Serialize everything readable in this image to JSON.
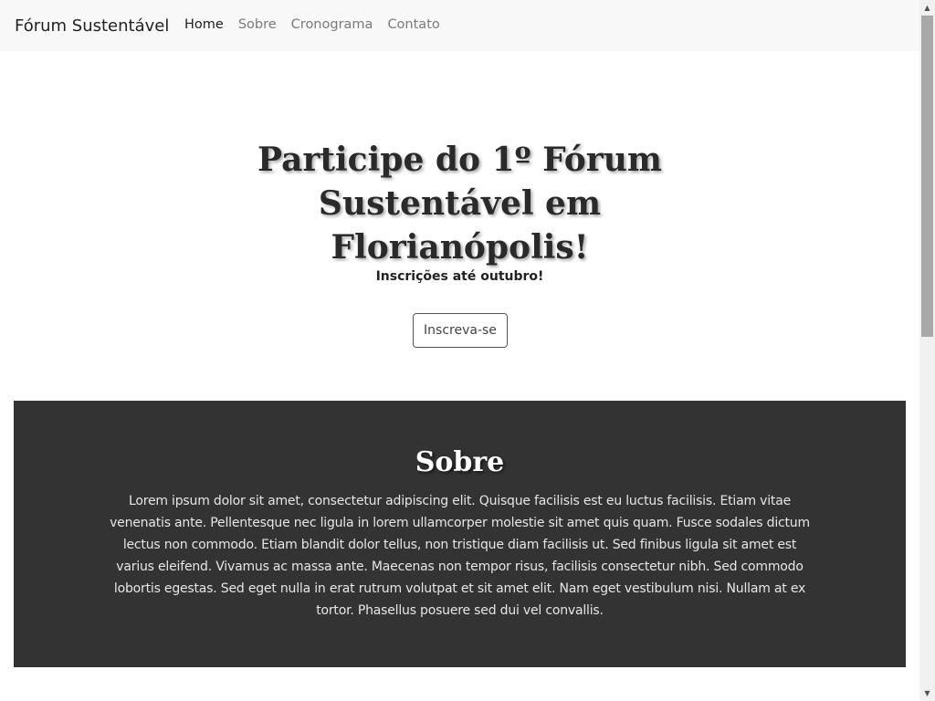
{
  "navbar": {
    "brand": "Fórum Sustentável",
    "links": [
      {
        "label": "Home",
        "active": true
      },
      {
        "label": "Sobre",
        "active": false
      },
      {
        "label": "Cronograma",
        "active": false
      },
      {
        "label": "Contato",
        "active": false
      }
    ]
  },
  "hero": {
    "title_lines": [
      "Participe do 1º Fórum",
      "Sustentável em",
      "Florianópolis!"
    ],
    "subtitle": "Inscrições até outubro!",
    "cta_label": "Inscreva-se"
  },
  "about": {
    "title": "Sobre",
    "text": "Lorem ipsum dolor sit amet, consectetur adipiscing elit. Quisque facilisis est eu luctus facilisis. Etiam vitae venenatis ante. Pellentesque nec ligula in lorem ullamcorper molestie sit amet quis quam. Fusce sodales dictum lectus non commodo. Etiam blandit dolor tellus, non tristique diam facilisis ut. Sed finibus ligula sit amet est varius eleifend. Vivamus ac massa ante. Maecenas non tempor risus, facilisis consectetur nibh. Sed commodo lobortis egestas. Sed eget nulla in erat rutrum volutpat et sit amet elit. Nam eget vestibulum nisi. Nullam at ex tortor. Phasellus posuere sed dui vel convallis."
  },
  "scrollbar": {
    "up_icon": "▲",
    "down_icon": "▼"
  },
  "colors": {
    "navbar_bg": "#f8f8f8",
    "about_bg": "#333333",
    "active_link": "#1f1f1f",
    "inactive_link": "#7a7a7a"
  }
}
